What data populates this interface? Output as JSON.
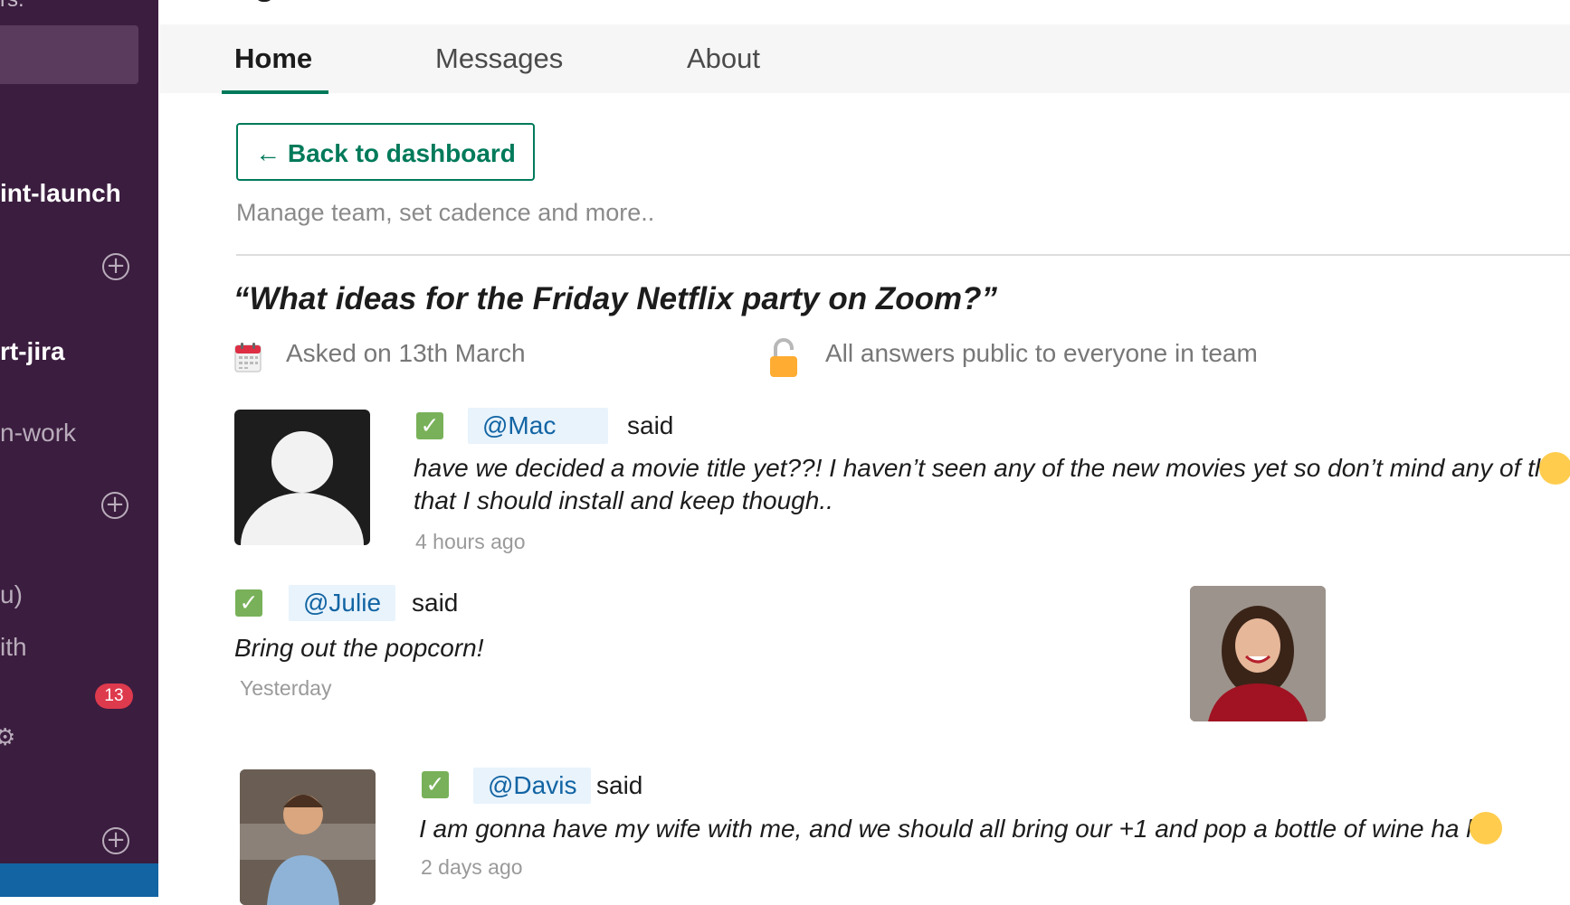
{
  "sidebar": {
    "top_fragment": "rs.",
    "items": [
      {
        "label": "int-launch"
      },
      {
        "label": "rt-jira"
      },
      {
        "label": "n-work"
      },
      {
        "label": "u)"
      },
      {
        "label": "ith"
      }
    ],
    "badge": "13"
  },
  "tabs": [
    {
      "label": "Home"
    },
    {
      "label": "Messages"
    },
    {
      "label": "About"
    }
  ],
  "back_button": "← Back to dashboard",
  "manage_text": "Manage team, set cadence and more..",
  "question": "“What ideas for the Friday Netflix party on Zoom?”",
  "meta": {
    "asked": "Asked on 13th March",
    "visibility": "All answers public to everyone in team"
  },
  "said_label": "said",
  "answers": [
    {
      "mention": "@Mac",
      "text_line1": "have we decided a movie title yet??! I haven’t seen any of the new movies yet so don’t mind any of them",
      "text_line2": "that I should install and keep though..",
      "time": "4 hours ago"
    },
    {
      "mention": "@Julie",
      "text": "Bring out the popcorn!",
      "time": "Yesterday"
    },
    {
      "mention": "@Davis",
      "text": "I am gonna have my wife with me, and we should all bring our +1 and pop a bottle of wine ha ha",
      "time": "2 days ago"
    }
  ],
  "colors": {
    "sidebar_bg": "#3b1d3f",
    "accent_green": "#007a5a",
    "mention_bg": "#e8f3fc",
    "mention_text": "#1264a3",
    "badge": "#de3a4d",
    "check": "#78b159"
  }
}
